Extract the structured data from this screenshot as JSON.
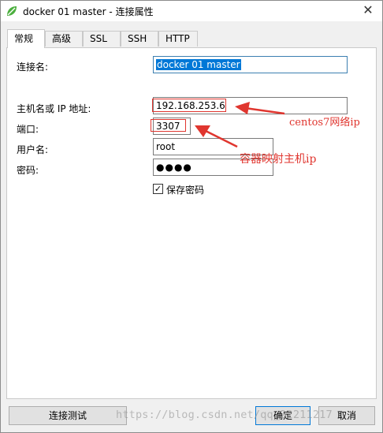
{
  "window": {
    "title": "docker 01 master - 连接属性",
    "close_glyph": "✕"
  },
  "tabs": [
    {
      "label": "常规",
      "active": true
    },
    {
      "label": "高级",
      "active": false
    },
    {
      "label": "SSL",
      "active": false
    },
    {
      "label": "SSH",
      "active": false
    },
    {
      "label": "HTTP",
      "active": false
    }
  ],
  "form": {
    "connection_name_label": "连接名:",
    "connection_name_value": "docker 01 master",
    "host_label": "主机名或 IP 地址:",
    "host_value": "192.168.253.6",
    "port_label": "端口:",
    "port_value": "3307",
    "username_label": "用户名:",
    "username_value": "root",
    "password_label": "密码:",
    "password_value": "●●●●",
    "save_password_label": "保存密码",
    "save_password_checked": true,
    "checkmark": "✓"
  },
  "annotations": {
    "host_note": "centos7网络ip",
    "port_note": "容器映射主机ip",
    "color": "#e0362f"
  },
  "footer": {
    "test_button": "连接测试",
    "ok_button": "确定",
    "cancel_button": "取消"
  },
  "watermark": "https://blog.csdn.net/qq_22211217"
}
